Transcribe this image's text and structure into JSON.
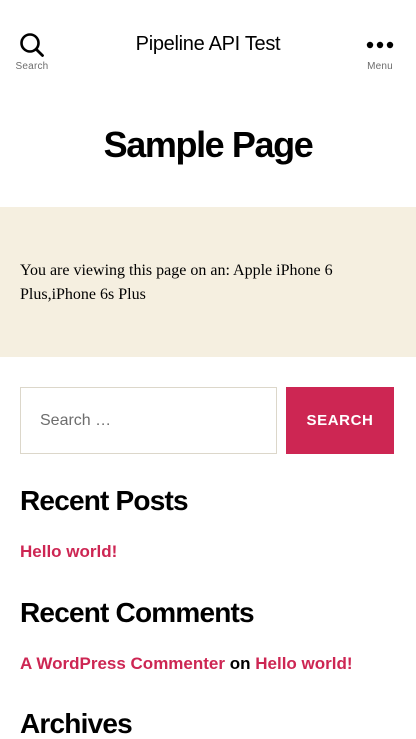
{
  "header": {
    "site_title": "Pipeline API Test",
    "search_toggle": {
      "icon": "search-icon",
      "label": "Search"
    },
    "menu_toggle": {
      "icon": "more-horizontal-icon",
      "label": "Menu"
    }
  },
  "page": {
    "title": "Sample Page",
    "content": "You are viewing this page on an: Apple iPhone 6 Plus,iPhone 6s Plus"
  },
  "search_form": {
    "placeholder": "Search …",
    "button_label": "SEARCH"
  },
  "widgets": {
    "recent_posts": {
      "title": "Recent Posts",
      "items": [
        "Hello world!"
      ]
    },
    "recent_comments": {
      "title": "Recent Comments",
      "items": [
        {
          "author": "A WordPress Commenter",
          "connector": "on",
          "post": "Hello world!"
        }
      ]
    },
    "archives": {
      "title": "Archives"
    }
  },
  "colors": {
    "accent": "#cd2653",
    "content_background": "#f5efe0",
    "input_border": "#dcd7ca"
  }
}
